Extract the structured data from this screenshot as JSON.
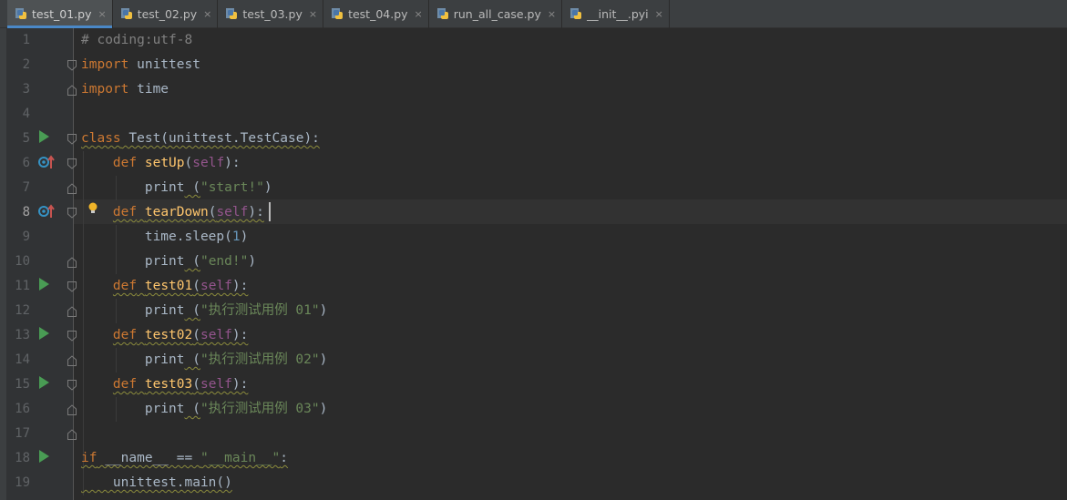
{
  "tabs": [
    {
      "label": "test_01.py",
      "active": true
    },
    {
      "label": "test_02.py",
      "active": false
    },
    {
      "label": "test_03.py",
      "active": false
    },
    {
      "label": "test_04.py",
      "active": false
    },
    {
      "label": "run_all_case.py",
      "active": false
    },
    {
      "label": "__init__.pyi",
      "active": false
    }
  ],
  "tab_close_glyph": "×",
  "line_numbers": [
    "1",
    "2",
    "3",
    "4",
    "5",
    "6",
    "7",
    "8",
    "9",
    "10",
    "11",
    "12",
    "13",
    "14",
    "15",
    "16",
    "17",
    "18",
    "19"
  ],
  "current_line": "8",
  "code": {
    "l1_comment": "# coding:utf-8",
    "l2_import": "import",
    "l2_module": " unittest",
    "l3_import": "import",
    "l3_module": " time",
    "l5_class": "class",
    "l5_rest": " Test(unittest.TestCase):",
    "l6_def": "def",
    "l6_name": "setUp",
    "l6_paren_open": "(",
    "l6_self": "self",
    "l6_paren_close": "):",
    "l7_print": "print",
    "l7_arg_open": " (",
    "l7_str": "\"start!\"",
    "l7_arg_close": ")",
    "l8_def": "def",
    "l8_name": "tearDown",
    "l8_paren_open": "(",
    "l8_self": "self",
    "l8_paren_close": "):",
    "l9_code": "time.sleep(",
    "l9_num": "1",
    "l9_close": ")",
    "l10_print": "print",
    "l10_arg_open": " (",
    "l10_str": "\"end!\"",
    "l10_arg_close": ")",
    "l11_def": "def",
    "l11_name": "test01",
    "l11_paren_open": "(",
    "l11_self": "self",
    "l11_paren_close": "):",
    "l12_print": "print",
    "l12_arg_open": " (",
    "l12_str": "\"执行测试用例 01\"",
    "l12_arg_close": ")",
    "l13_def": "def",
    "l13_name": "test02",
    "l13_paren_open": "(",
    "l13_self": "self",
    "l13_paren_close": "):",
    "l14_print": "print",
    "l14_arg_open": " (",
    "l14_str": "\"执行测试用例 02\"",
    "l14_arg_close": ")",
    "l15_def": "def",
    "l15_name": "test03",
    "l15_paren_open": "(",
    "l15_self": "self",
    "l15_paren_close": "):",
    "l16_print": "print",
    "l16_arg_open": " (",
    "l16_str": "\"执行测试用例 03\"",
    "l16_arg_close": ")",
    "l18_if": "if",
    "l18_mid": " __name__ == ",
    "l18_str": "\"__main__\"",
    "l18_colon": ":",
    "l19_code": "unittest.main()"
  },
  "colors": {
    "background": "#2b2b2b",
    "keyword": "#cc7832",
    "function": "#ffc66d",
    "self": "#94558d",
    "string": "#6a8759",
    "number": "#6897bb",
    "comment": "#808080",
    "run_icon": "#499c54",
    "tab_active_underline": "#4a88c7"
  },
  "icons": {
    "tab_file": "python-file-icon",
    "run": "run-triangle-icon",
    "override": "overriding-method-icon",
    "bulb": "intention-bulb-icon",
    "fold": "fold-marker-icon"
  }
}
